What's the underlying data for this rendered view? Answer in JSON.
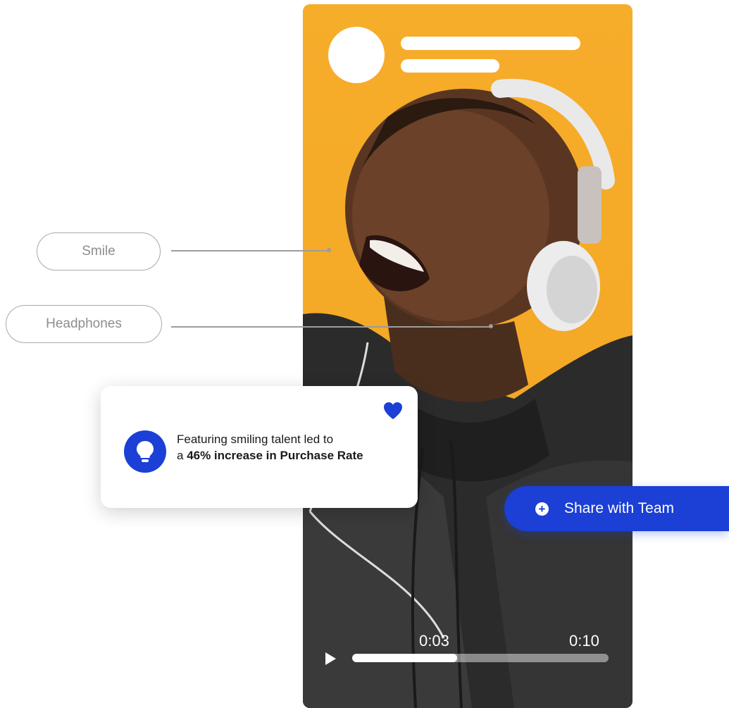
{
  "tags": {
    "smile": "Smile",
    "headphones": "Headphones"
  },
  "insight": {
    "line1": "Featuring smiling talent led to",
    "line2_prefix": "a ",
    "line2_bold": "46% increase in Purchase Rate",
    "icon": "lightbulb-icon",
    "favorite_icon": "heart-icon"
  },
  "share_button": {
    "label": "Share with Team",
    "icon": "plus-circle-icon"
  },
  "video": {
    "current_time": "0:03",
    "total_time": "0:10",
    "progress": 0.41,
    "play_icon": "play-icon"
  },
  "colors": {
    "accent": "#1c3fd6",
    "background": "#f6ad2a"
  }
}
